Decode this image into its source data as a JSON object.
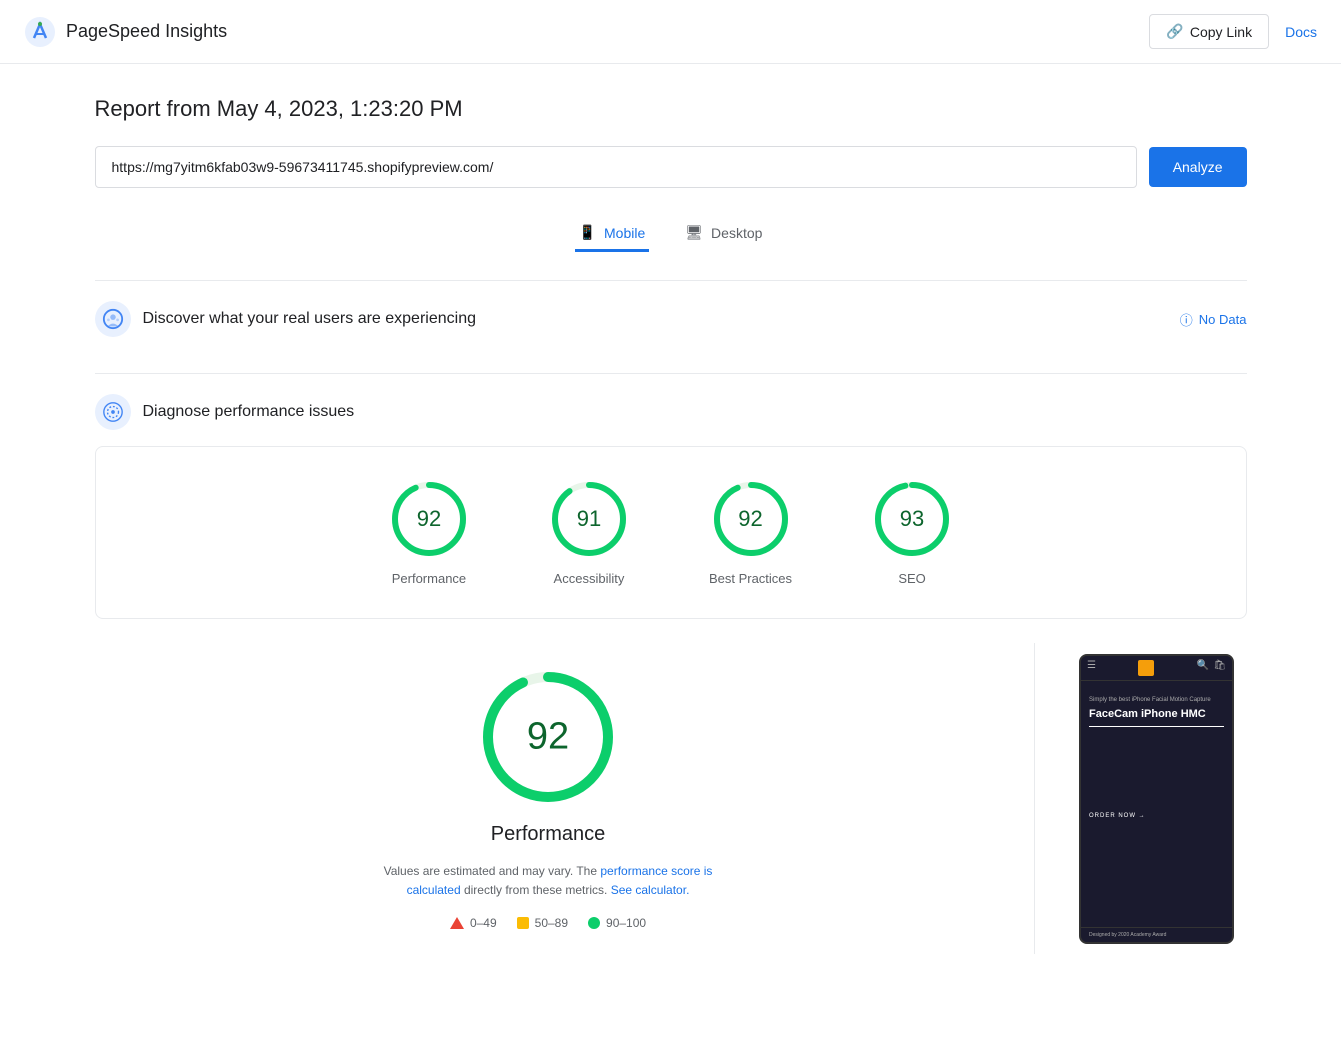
{
  "header": {
    "app_name": "PageSpeed Insights",
    "copy_link_label": "Copy Link",
    "docs_label": "Docs"
  },
  "report": {
    "title": "Report from May 4, 2023, 1:23:20 PM",
    "url": "https://mg7yitm6kfab03w9-59673411745.shopifypreview.com/",
    "analyze_label": "Analyze"
  },
  "device_tabs": [
    {
      "id": "mobile",
      "label": "Mobile",
      "icon": "📱",
      "active": true
    },
    {
      "id": "desktop",
      "label": "Desktop",
      "icon": "🖥",
      "active": false
    }
  ],
  "sections": {
    "discover": {
      "title": "Discover what your real users are experiencing",
      "no_data_label": "No Data"
    },
    "diagnose": {
      "title": "Diagnose performance issues"
    }
  },
  "scores": [
    {
      "id": "performance",
      "label": "Performance",
      "value": 92,
      "color": "#0cce6b",
      "track": "#e8f5e9"
    },
    {
      "id": "accessibility",
      "label": "Accessibility",
      "value": 91,
      "color": "#0cce6b",
      "track": "#e8f5e9"
    },
    {
      "id": "best-practices",
      "label": "Best Practices",
      "value": 92,
      "color": "#0cce6b",
      "track": "#e8f5e9"
    },
    {
      "id": "seo",
      "label": "SEO",
      "value": 93,
      "color": "#0cce6b",
      "track": "#e8f5e9"
    }
  ],
  "performance_detail": {
    "score": 92,
    "title": "Performance",
    "desc_static": "Values are estimated and may vary. The",
    "desc_link1": "performance score is calculated",
    "desc_mid": "directly from these metrics.",
    "desc_link2": "See calculator",
    "legend": [
      {
        "type": "triangle",
        "range": "0–49"
      },
      {
        "type": "square",
        "range": "50–89"
      },
      {
        "type": "circle",
        "range": "90–100"
      }
    ]
  },
  "phone_content": {
    "subtitle": "Simply the best iPhone Facial Motion Capture",
    "title": "FaceCam iPhone\nHMC",
    "cta": "ORDER NOW  →",
    "footer": "Designed by 2020 Academy Award"
  }
}
